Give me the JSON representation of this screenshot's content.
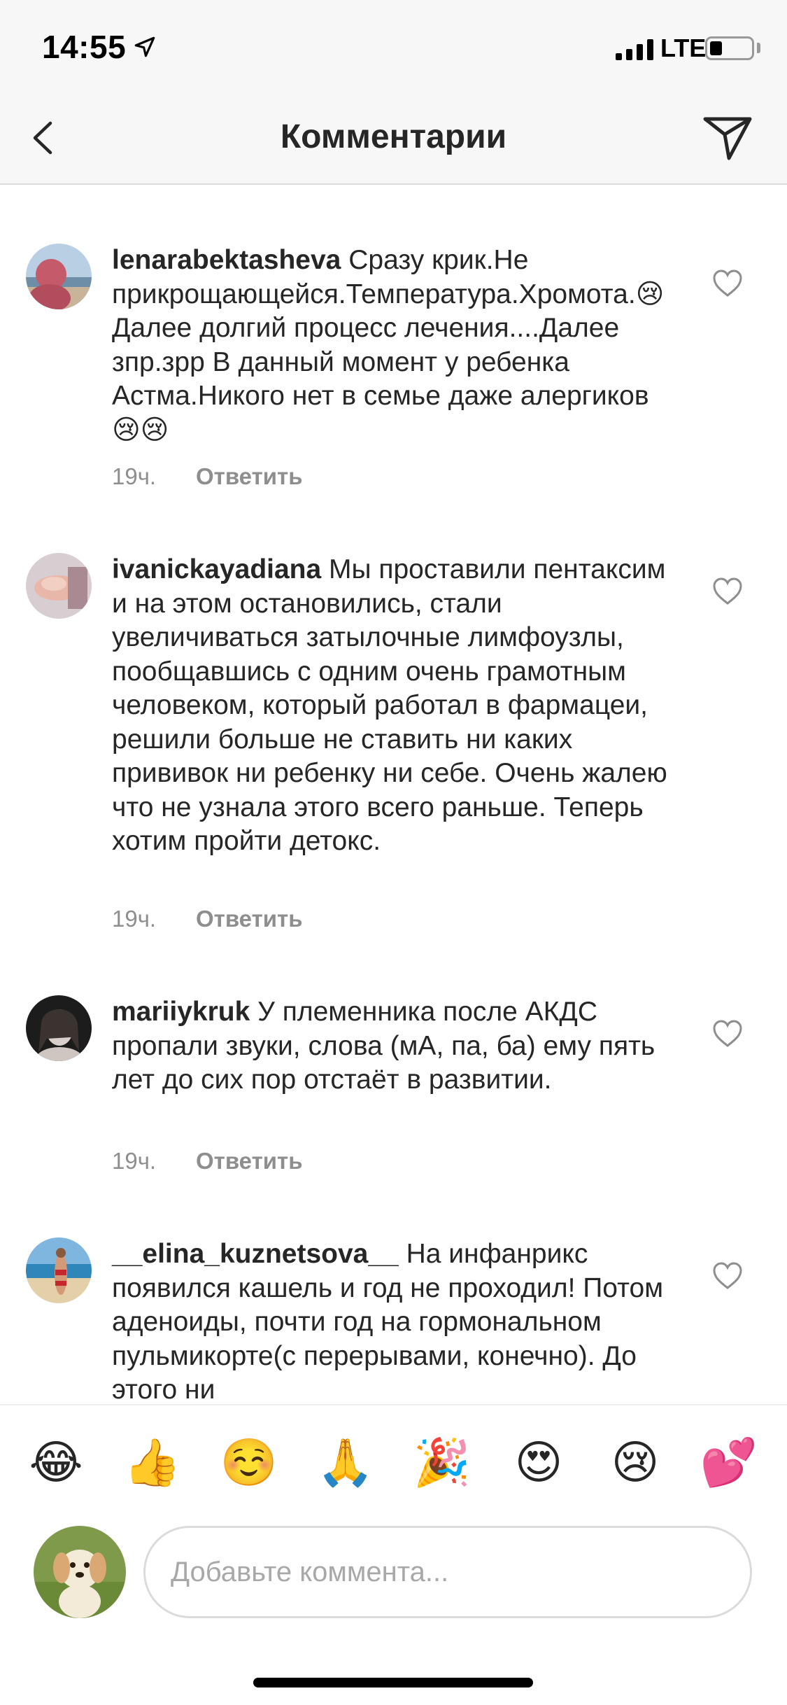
{
  "status_bar": {
    "time": "14:55",
    "network": "LTE",
    "battery_level": 0.3
  },
  "header": {
    "title": "Комментарии",
    "back_icon": "chevron-left-icon",
    "send_icon": "paper-plane-icon"
  },
  "comments": [
    {
      "username": "lenarabektasheva",
      "text": " Сразу крик.Не прикрощающейся.Температура.Хромота.😢Далее долгий процесс лечения....Далее зпр.зрр В данный момент у ребенка Астма.Никого нет в семье даже алергиков😢😢",
      "time": "19ч.",
      "reply_label": "Ответить"
    },
    {
      "username": "ivanickayadiana",
      "text": " Мы проставили пентаксим и на этом остановились, стали увеличиваться затылочные лимфоузлы, пообщавшись с одним очень грамотным человеком, который работал в фармацеи, решили больше не ставить ни каких прививок ни ребенку ни себе. Очень жалею что не узнала этого всего раньше. Теперь хотим пройти детокс.",
      "time": "19ч.",
      "reply_label": "Ответить"
    },
    {
      "username": "mariiykruk",
      "text": " У племенника после АКДС пропали звуки, слова (мА, па, ба) ему пять лет до сих пор отстаёт в развитии.",
      "time": "19ч.",
      "reply_label": "Ответить"
    },
    {
      "username": "__elina_kuznetsova__",
      "text": " На инфанрикс появился кашель и год не проходил! Потом аденоиды, почти год на гормональном пульмикорте(с перерывами, конечно). До этого ни",
      "time": "",
      "reply_label": ""
    }
  ],
  "emoji_bar": [
    "😂",
    "👍",
    "☺️",
    "🙏",
    "🎉",
    "😍",
    "😢",
    "💕"
  ],
  "input": {
    "placeholder": "Добавьте коммента..."
  }
}
